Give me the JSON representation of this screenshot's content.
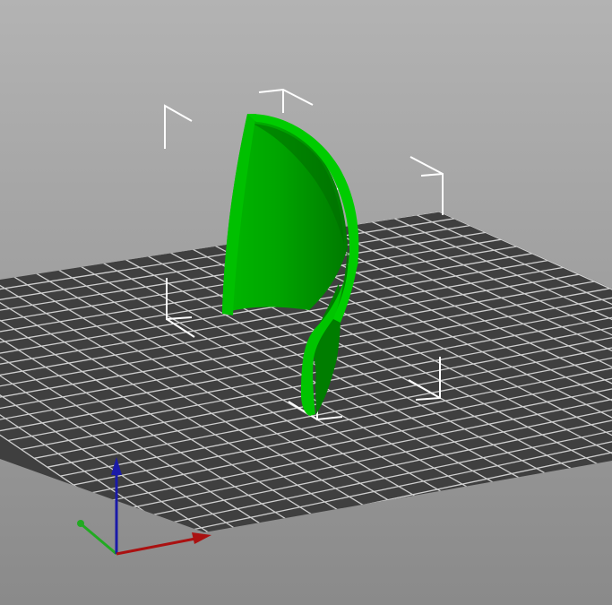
{
  "viewport": {
    "background_top": "#b3b3b3",
    "background_bottom": "#8a8a8a"
  },
  "bed": {
    "tile_color": "#3f3f3f",
    "grid_line_color": "#cfcfcf"
  },
  "model": {
    "name": "curved-shell-part",
    "selected": true,
    "color_light": "#00c800",
    "color_mid": "#00a800",
    "color_dark": "#008a00"
  },
  "bounding_box": {
    "color": "#ffffff"
  },
  "axes": {
    "x_color": "#aa1111",
    "y_color": "#22aa22",
    "z_color": "#1a1aa8"
  }
}
